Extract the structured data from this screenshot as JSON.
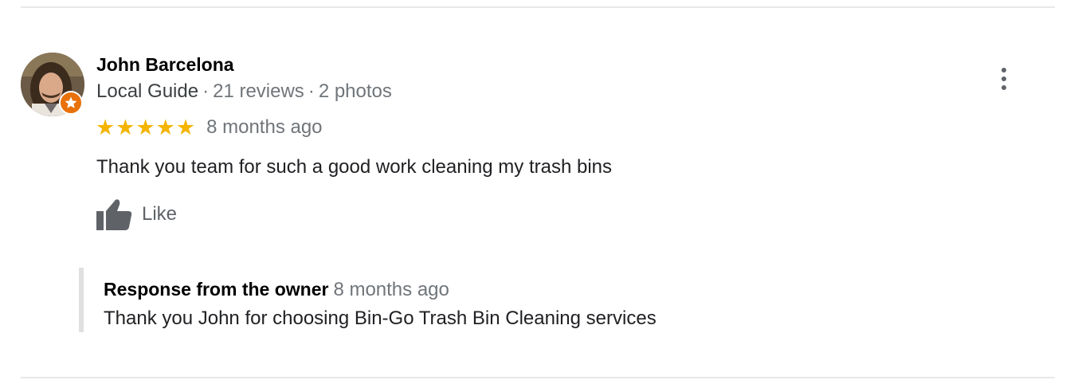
{
  "review": {
    "author": "John Barcelona",
    "guide_label": "Local Guide",
    "reviews_count": "21 reviews",
    "photos_count": "2 photos",
    "separator": "·",
    "rating": 5,
    "star_glyph": "★",
    "date": "8 months ago",
    "text": "Thank you team for such a good work cleaning my trash bins",
    "like_label": "Like",
    "more_icon": "more-vert-icon"
  },
  "owner_response": {
    "title": "Response from the owner",
    "date": "8 months ago",
    "text": "Thank you John for choosing Bin-Go Trash Bin Cleaning services"
  },
  "colors": {
    "star": "#f4b400",
    "badge": "#e8710a",
    "muted": "#70757a"
  }
}
